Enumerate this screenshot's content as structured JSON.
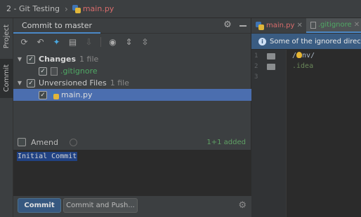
{
  "breadcrumb": {
    "project": "2 - Git Testing",
    "file": "main.py"
  },
  "stripe": {
    "project_tab": "Project",
    "commit_tab": "Commit"
  },
  "commit_panel": {
    "tab_title": "Commit to master",
    "changes": {
      "label": "Changes",
      "count": "1 file"
    },
    "changes_files": [
      {
        "name": ".gitignore"
      }
    ],
    "unversioned": {
      "label": "Unversioned Files",
      "count": "1 file"
    },
    "unversioned_files": [
      {
        "name": "main.py"
      }
    ],
    "amend_label": "Amend",
    "added_status": "1+1 added",
    "commit_message": "Initial Commit",
    "commit_button": "Commit",
    "commit_push_button": "Commit and Push..."
  },
  "editor": {
    "tabs": [
      {
        "label": "main.py",
        "active": false
      },
      {
        "label": ".gitignore",
        "active": true
      }
    ],
    "banner": "Some of the ignored directories are not excluded from indexing and search",
    "lines": [
      {
        "number": "1",
        "text_prefix": "/",
        "text_rest": "nv/"
      },
      {
        "number": "2",
        "text": ".idea"
      },
      {
        "number": "3",
        "text": ""
      }
    ]
  },
  "colors": {
    "accent": "#4a88c7",
    "selection": "#4b6eaf",
    "primary_button": "#365880",
    "added_green": "#5fa064",
    "modified_red": "#d96c6c"
  }
}
